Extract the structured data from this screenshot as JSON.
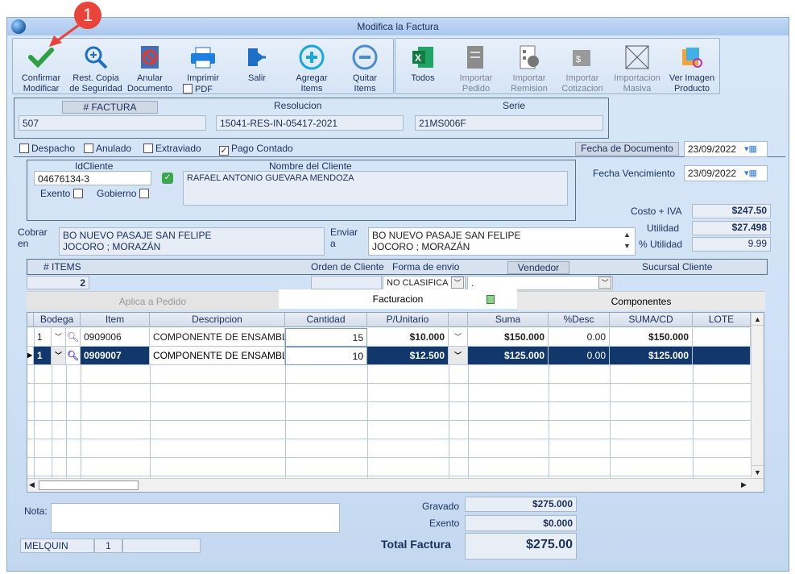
{
  "window": {
    "title": "Modifica la Factura"
  },
  "badge": "1",
  "toolbar": {
    "confirm": "Confirmar\nModificar",
    "rest": "Rest. Copia\nde Seguridad",
    "anular": "Anular\nDocumento",
    "imprimir": "Imprimir",
    "pdf": "PDF",
    "salir": "Salir",
    "agregar": "Agregar\nItems",
    "quitar": "Quitar\nItems",
    "todos": "Todos",
    "imp_pedido": "Importar\nPedido",
    "imp_remision": "Importar\nRemision",
    "imp_cotizacion": "Importar\nCotizacion",
    "imp_masiva": "Importacion\nMasiva",
    "ver_imagen": "Ver Imagen\nProducto"
  },
  "header": {
    "factura_label": "# FACTURA",
    "factura": "507",
    "resolucion_label": "Resolucion",
    "resolucion": "15041-RES-IN-05417-2021",
    "serie_label": "Serie",
    "serie": "21MS006F"
  },
  "flags": {
    "despacho": "Despacho",
    "anulado": "Anulado",
    "extraviado": "Extraviado",
    "pago_contado": "Pago Contado"
  },
  "fecha_doc": {
    "label": "Fecha de Documento",
    "value": "23/09/2022"
  },
  "fecha_venc": {
    "label": "Fecha Vencimiento",
    "value": "23/09/2022"
  },
  "cliente": {
    "id_label": "IdCliente",
    "id": "04676134-3",
    "nombre_label": "Nombre del Cliente",
    "nombre": "RAFAEL ANTONIO GUEVARA MENDOZA",
    "exento": "Exento",
    "gobierno": "Gobierno"
  },
  "costos": {
    "costo_label": "Costo + IVA",
    "costo": "$247.50",
    "utilidad_label": "Utilidad",
    "utilidad": "$27.498",
    "pct_label": "% Utilidad",
    "pct": "9.99"
  },
  "cobrar": {
    "label1": "Cobrar",
    "label2": "en",
    "line1": "BO NUEVO PASAJE SAN FELIPE",
    "line2": "JOCORO ; MORAZÁN"
  },
  "enviar": {
    "label1": "Enviar",
    "label2": "a",
    "line1": "BO NUEVO PASAJE SAN FELIPE",
    "line2": "JOCORO ; MORAZÁN"
  },
  "info": {
    "items_label": "# ITEMS",
    "items": "2",
    "orden_label": "Orden de Cliente",
    "forma_label": "Forma de envio",
    "forma": "NO CLASIFICA",
    "vendedor_label": "Vendedor",
    "vendedor": ".",
    "sucursal_label": "Sucursal Cliente"
  },
  "tabs": {
    "pedido": "Aplica a Pedido",
    "facturacion": "Facturacion",
    "componentes": "Componentes"
  },
  "grid": {
    "columns": [
      "Bodega",
      "Item",
      "Descripcion",
      "Cantidad",
      "P/Unitario",
      "Suma",
      "%Desc",
      "SUMA/CD",
      "LOTE"
    ],
    "rows": [
      {
        "bodega": "1",
        "item": "0909006",
        "desc": "COMPONENTE DE ENSAMBL",
        "cant": "15",
        "punit": "$10.000",
        "suma": "$150.000",
        "desc_pct": "0.00",
        "sumacd": "$150.000"
      },
      {
        "bodega": "1",
        "item": "0909007",
        "desc": "COMPONENTE DE ENSAMBL",
        "cant": "10",
        "punit": "$12.500",
        "suma": "$125.000",
        "desc_pct": "0.00",
        "sumacd": "$125.000"
      }
    ]
  },
  "nota_label": "Nota:",
  "totales": {
    "gravado_label": "Gravado",
    "gravado": "$275.000",
    "exento_label": "Exento",
    "exento": "$0.000",
    "total_label": "Total Factura",
    "total": "$275.00"
  },
  "status": {
    "user": "MELQUIN",
    "num": "1"
  }
}
